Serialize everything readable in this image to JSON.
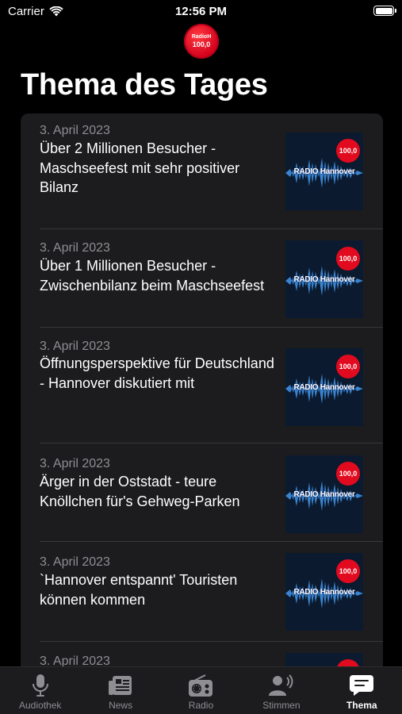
{
  "status_bar": {
    "carrier": "Carrier",
    "time": "12:56 PM"
  },
  "logo": {
    "top": "RadioH",
    "bottom": "100,0"
  },
  "page": {
    "title": "Thema des Tages"
  },
  "thumbnail": {
    "badge": "100,0",
    "label": "RADIO Hannover"
  },
  "items": [
    {
      "date": "3. April 2023",
      "title": "Über 2 Millionen Besucher - Maschseefest mit sehr positiver Bilanz"
    },
    {
      "date": "3. April 2023",
      "title": "Über 1 Millionen Besucher - Zwischenbilanz beim Maschseefest"
    },
    {
      "date": "3. April 2023",
      "title": "Öffnungsperspektive für Deutschland - Hannover diskutiert mit"
    },
    {
      "date": "3. April 2023",
      "title": "Ärger in der Oststadt - teure Knöllchen für's Gehweg-Parken"
    },
    {
      "date": "3. April 2023",
      "title": "`Hannover entspannt' Touristen können kommen"
    },
    {
      "date": "3. April 2023",
      "title": ""
    }
  ],
  "tabs": [
    {
      "label": "Audiothek",
      "icon": "microphone-icon"
    },
    {
      "label": "News",
      "icon": "newspaper-icon"
    },
    {
      "label": "Radio",
      "icon": "radio-icon"
    },
    {
      "label": "Stimmen",
      "icon": "speaking-person-icon"
    },
    {
      "label": "Thema",
      "icon": "speech-bubble-icon",
      "active": true
    }
  ],
  "colors": {
    "background": "#000000",
    "card": "#1c1c1e",
    "accent_red": "#e10a1e",
    "muted": "#8e8e93"
  }
}
